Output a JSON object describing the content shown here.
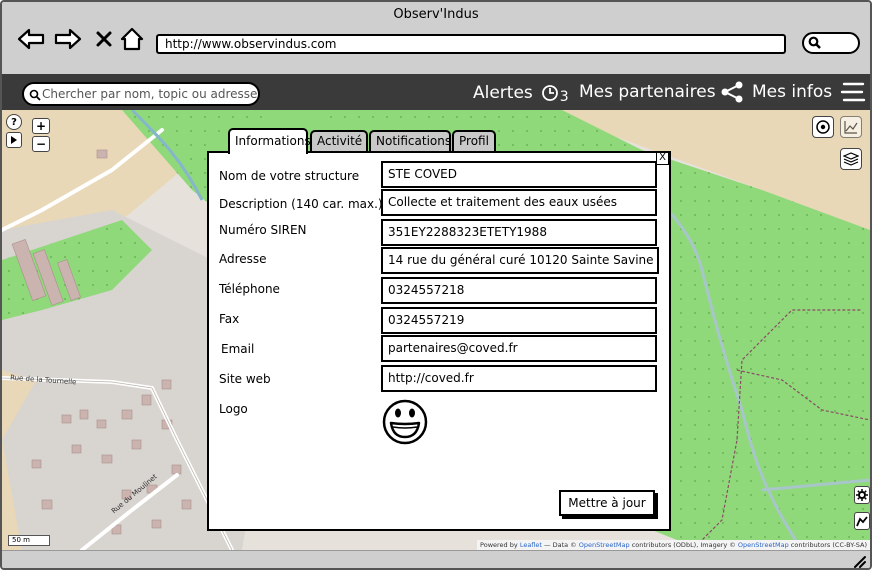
{
  "window": {
    "title": "Observ'Indus"
  },
  "browser": {
    "url": "http://www.observindus.com",
    "icons": [
      "back-arrow-icon",
      "forward-arrow-icon",
      "close-x-icon",
      "home-icon",
      "search-icon"
    ]
  },
  "appbar": {
    "search_placeholder": "Chercher par nom, topic ou adresse",
    "alerts_label": "Alertes",
    "alerts_count": "3",
    "partners_label": "Mes partenaires",
    "myinfo_label": "Mes infos"
  },
  "map": {
    "street_1": "Rue de la Tournelle",
    "street_2": "Rue du Moulinet",
    "scale": "50 m",
    "attribution": {
      "powered": "Powered by",
      "leaflet": "Leaflet",
      "data": "— Data ©",
      "osm1": "OpenStreetMap",
      "contrib1": "contributors (ODbL), Imagery ©",
      "osm2": "OpenStreetMap",
      "contrib2": "contributors (CC-BY-SA)"
    },
    "colors": {
      "green": "#7fd36b",
      "beige": "#e6e2db",
      "tan": "#e9d8b8",
      "gray": "#d8d4d0",
      "building": "#cbb3b0"
    }
  },
  "dialog": {
    "tabs": [
      {
        "label": "Informations",
        "active": true
      },
      {
        "label": "Activité",
        "active": false
      },
      {
        "label": "Notifications",
        "active": false
      },
      {
        "label": "Profil",
        "active": false
      }
    ],
    "close_label": "X",
    "fields": [
      {
        "label": "Nom de votre structure",
        "value": "STE COVED"
      },
      {
        "label": "Description (140 car. max.)",
        "value": "Collecte et traitement des eaux usées"
      },
      {
        "label": "Numéro SIREN",
        "value": "351EY2288323ETETY1988"
      },
      {
        "label": "Adresse",
        "value": "14 rue du général curé 10120 Sainte Savine"
      },
      {
        "label": "Téléphone",
        "value": "0324557218"
      },
      {
        "label": "Fax",
        "value": "0324557219"
      },
      {
        "label": "Email",
        "value": "partenaires@coved.fr"
      },
      {
        "label": "Site web",
        "value": "http://coved.fr"
      }
    ],
    "logo_label": "Logo",
    "update_button": "Mettre à jour"
  }
}
